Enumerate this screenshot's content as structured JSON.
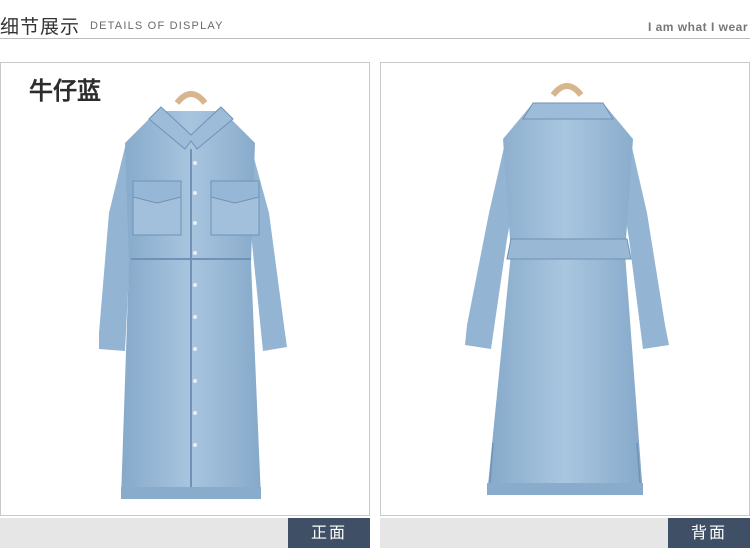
{
  "header": {
    "title": "细节展示",
    "subtitle": "DETAILS OF DISPLAY",
    "tagline": "I am what I wear"
  },
  "panels": {
    "front": {
      "color_label": "牛仔蓝",
      "caption": "正面"
    },
    "back": {
      "caption": "背面"
    }
  },
  "colors": {
    "denim_light": "#a9c6df",
    "denim_mid": "#8fb1d0",
    "denim_dark": "#7497bb",
    "caption_bar": "#e6e6e6",
    "caption_tag": "#3e4f66"
  }
}
